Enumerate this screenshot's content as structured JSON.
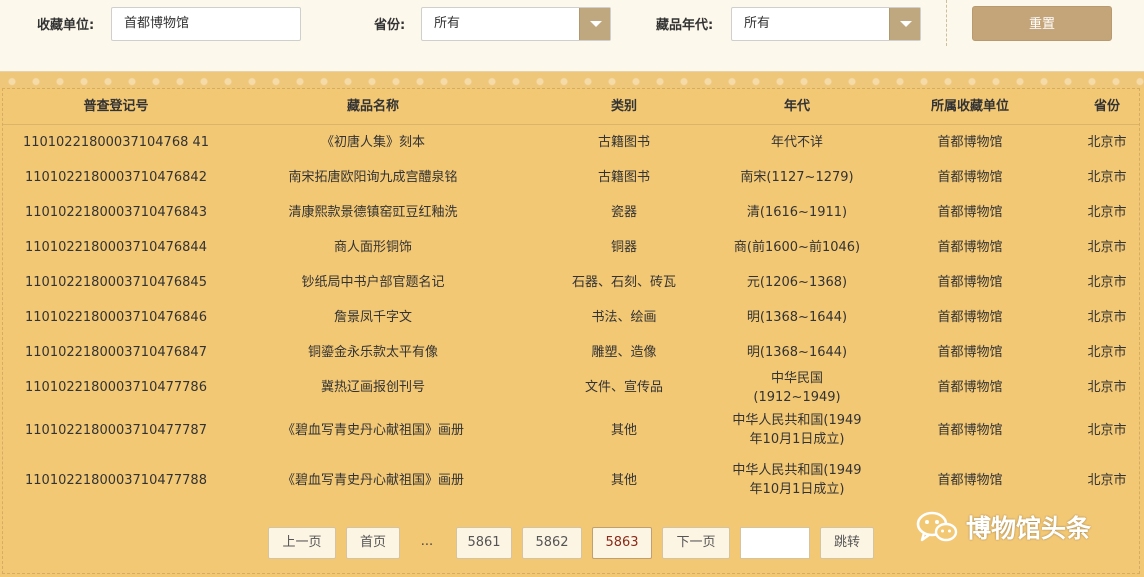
{
  "filters": {
    "unit_label": "收藏单位:",
    "unit_value": "首都博物馆",
    "province_label": "省份:",
    "province_value": "所有",
    "era_label": "藏品年代:",
    "era_value": "所有",
    "reset_label": "重置"
  },
  "table": {
    "headers": [
      "普查登记号",
      "藏品名称",
      "类别",
      "年代",
      "所属收藏单位",
      "省份"
    ],
    "rows": [
      [
        "11010221800037104768 41",
        "《初唐人集》刻本",
        "古籍图书",
        "年代不详",
        "首都博物馆",
        "北京市"
      ],
      [
        "1101022180003710476842",
        "南宋拓唐欧阳询九成宫醴泉铭",
        "古籍图书",
        "南宋(1127~1279)",
        "首都博物馆",
        "北京市"
      ],
      [
        "1101022180003710476843",
        "清康熙款景德镇窑豇豆红釉洗",
        "瓷器",
        "清(1616~1911)",
        "首都博物馆",
        "北京市"
      ],
      [
        "1101022180003710476844",
        "商人面形铜饰",
        "铜器",
        "商(前1600~前1046)",
        "首都博物馆",
        "北京市"
      ],
      [
        "1101022180003710476845",
        "钞纸局中书户部官题名记",
        "石器、石刻、砖瓦",
        "元(1206~1368)",
        "首都博物馆",
        "北京市"
      ],
      [
        "1101022180003710476846",
        "詹景凤千字文",
        "书法、绘画",
        "明(1368~1644)",
        "首都博物馆",
        "北京市"
      ],
      [
        "1101022180003710476847",
        "铜鎏金永乐款太平有像",
        "雕塑、造像",
        "明(1368~1644)",
        "首都博物馆",
        "北京市"
      ],
      [
        "1101022180003710477786",
        "冀热辽画报创刊号",
        "文件、宣传品",
        "中华民国(1912~1949)",
        "首都博物馆",
        "北京市"
      ],
      [
        "1101022180003710477787",
        "《碧血写青史丹心献祖国》画册",
        "其他",
        "中华人民共和国(1949年10月1日成立)",
        "首都博物馆",
        "北京市"
      ],
      [
        "1101022180003710477788",
        "《碧血写青史丹心献祖国》画册",
        "其他",
        "中华人民共和国(1949年10月1日成立)",
        "首都博物馆",
        "北京市"
      ]
    ]
  },
  "pagination": {
    "prev": "上一页",
    "first": "首页",
    "ellipsis": "...",
    "pages": [
      "5861",
      "5862",
      "5863"
    ],
    "current_page": "5863",
    "next": "下一页",
    "jump_input": "",
    "jump": "跳转"
  },
  "watermark": {
    "text": "博物馆头条",
    "icon": "wechat-icon"
  }
}
